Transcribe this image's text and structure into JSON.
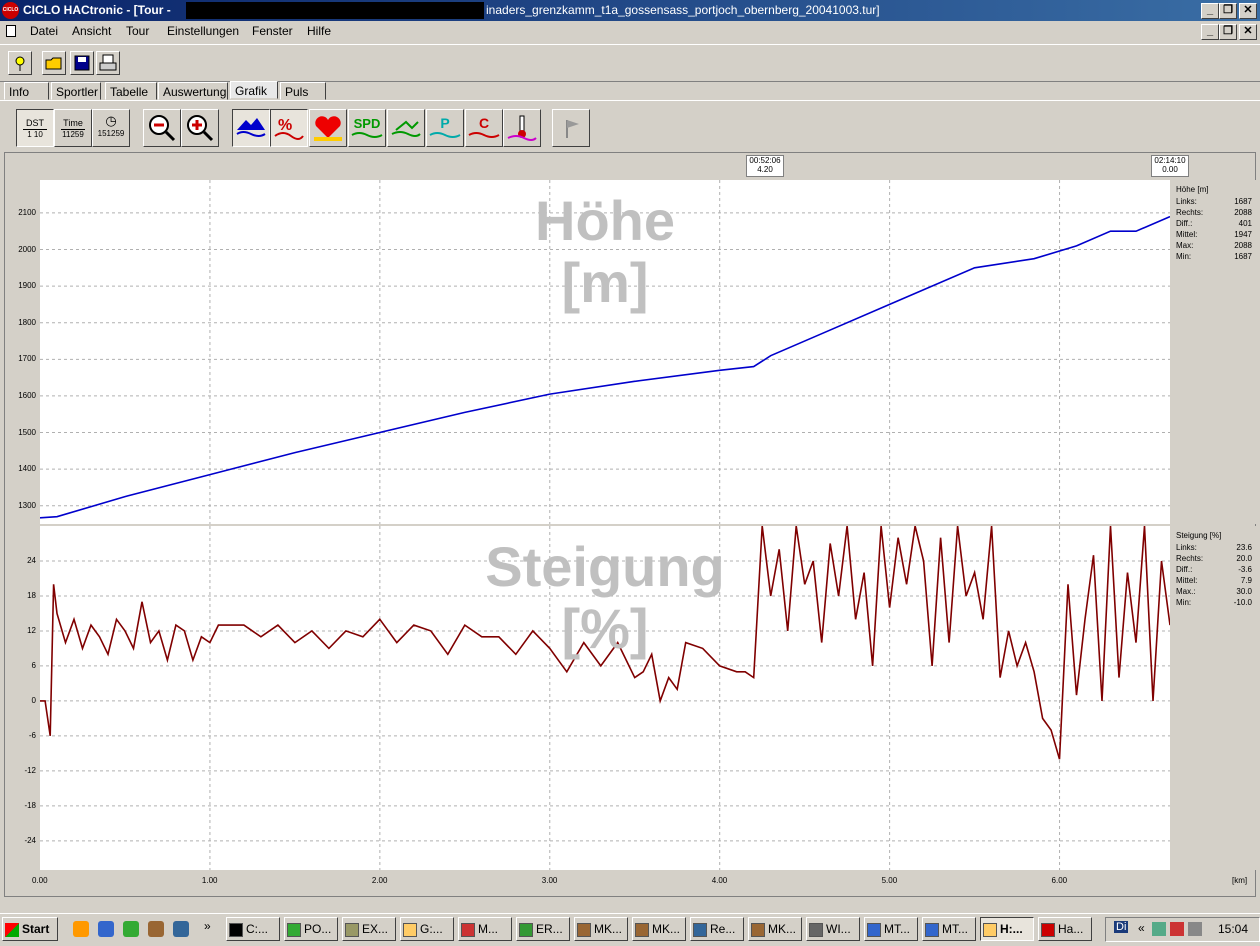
{
  "window": {
    "logo": "CICLO",
    "title_left": "CICLO HACtronic - [Tour -",
    "title_right": "inaders_grenzkamm_t1a_gossensass_portjoch_obernberg_20041003.tur]"
  },
  "menu": [
    "Datei",
    "Ansicht",
    "Tour",
    "Einstellungen",
    "Fenster",
    "Hilfe"
  ],
  "toolbar": [
    "new-icon",
    "open-icon",
    "save-icon",
    "print-icon"
  ],
  "tabs": [
    {
      "label": "Info"
    },
    {
      "label": "Sportler"
    },
    {
      "label": "Tabelle"
    },
    {
      "label": "Auswertung"
    },
    {
      "label": "Grafik",
      "active": true
    },
    {
      "label": "Puls"
    }
  ],
  "graph_toolbar": {
    "dst": {
      "label": "DST",
      "value": "1 10"
    },
    "time": {
      "label": "Time",
      "value": "11259"
    },
    "clock": {
      "value": "151259"
    },
    "spd_label": "SPD",
    "p_label": "P",
    "c_label": "C"
  },
  "markers": [
    {
      "time": "00:52:06",
      "value": "4.20"
    },
    {
      "time": "02:14:10",
      "value": "0.00"
    }
  ],
  "x_axis": {
    "unit": "[km]",
    "ticks": [
      "0.00",
      "1.00",
      "2.00",
      "3.00",
      "4.00",
      "5.00",
      "6.00"
    ]
  },
  "hoehe_panel": {
    "title": "Höhe [m]",
    "big_title": [
      "Höhe",
      "[m]"
    ],
    "stats": [
      {
        "k": "Links:",
        "v": "1687"
      },
      {
        "k": "Rechts:",
        "v": "2088"
      },
      {
        "k": "Diff.:",
        "v": "401"
      },
      {
        "k": "Mittel:",
        "v": "1947"
      },
      {
        "k": "Max:",
        "v": "2088"
      },
      {
        "k": "Min:",
        "v": "1687"
      }
    ]
  },
  "steigung_panel": {
    "title": "Steigung [%]",
    "big_title": [
      "Steigung",
      "[%]"
    ],
    "stats": [
      {
        "k": "Links:",
        "v": "23.6"
      },
      {
        "k": "Rechts:",
        "v": "20.0"
      },
      {
        "k": "Diff.:",
        "v": "-3.6"
      },
      {
        "k": "Mittel:",
        "v": "7.9"
      },
      {
        "k": "Max.:",
        "v": "30.0"
      },
      {
        "k": "Min:",
        "v": "-10.0"
      }
    ]
  },
  "chart_data": [
    {
      "type": "line",
      "title": "Höhe [m]",
      "xlabel": "[km]",
      "ylim": [
        1250,
        2190
      ],
      "xlim": [
        0,
        6.65
      ],
      "yticks": [
        1300,
        1400,
        1500,
        1600,
        1700,
        1800,
        1900,
        2000,
        2100
      ],
      "grid": true,
      "color": "#0000cc",
      "x": [
        0,
        0.1,
        0.5,
        1.0,
        1.5,
        2.0,
        2.5,
        3.0,
        3.5,
        4.0,
        4.2,
        4.3,
        4.6,
        5.0,
        5.5,
        5.85,
        6.1,
        6.3,
        6.45,
        6.65
      ],
      "y": [
        1267,
        1270,
        1325,
        1385,
        1445,
        1500,
        1555,
        1605,
        1640,
        1670,
        1680,
        1710,
        1770,
        1850,
        1950,
        1975,
        2010,
        2050,
        2050,
        2090
      ]
    },
    {
      "type": "line",
      "title": "Steigung [%]",
      "xlabel": "[km]",
      "ylim": [
        -29,
        30
      ],
      "xlim": [
        0,
        6.65
      ],
      "yticks": [
        24,
        18,
        12,
        6,
        0,
        -6,
        -12,
        -18,
        -24
      ],
      "ytick_labels": [
        "24",
        "18",
        "12",
        "6",
        "0",
        "-6",
        "-12",
        "-18",
        "-24"
      ],
      "grid": true,
      "color": "#800000",
      "x": [
        0.0,
        0.03,
        0.06,
        0.08,
        0.1,
        0.15,
        0.2,
        0.25,
        0.3,
        0.35,
        0.4,
        0.45,
        0.5,
        0.55,
        0.6,
        0.65,
        0.7,
        0.75,
        0.8,
        0.85,
        0.9,
        0.95,
        1.0,
        1.05,
        1.1,
        1.2,
        1.3,
        1.4,
        1.5,
        1.6,
        1.7,
        1.8,
        1.9,
        2.0,
        2.1,
        2.2,
        2.3,
        2.4,
        2.5,
        2.6,
        2.7,
        2.8,
        2.9,
        3.0,
        3.1,
        3.2,
        3.3,
        3.4,
        3.5,
        3.55,
        3.6,
        3.65,
        3.7,
        3.75,
        3.8,
        3.9,
        4.0,
        4.1,
        4.15,
        4.2,
        4.25,
        4.3,
        4.35,
        4.4,
        4.45,
        4.5,
        4.55,
        4.6,
        4.65,
        4.7,
        4.75,
        4.8,
        4.85,
        4.9,
        4.95,
        5.0,
        5.05,
        5.1,
        5.15,
        5.2,
        5.25,
        5.3,
        5.35,
        5.4,
        5.45,
        5.5,
        5.55,
        5.6,
        5.65,
        5.7,
        5.75,
        5.8,
        5.85,
        5.9,
        5.95,
        6.0,
        6.05,
        6.1,
        6.15,
        6.2,
        6.25,
        6.3,
        6.35,
        6.4,
        6.45,
        6.5,
        6.55,
        6.6,
        6.65
      ],
      "y": [
        0,
        0,
        -6,
        20,
        15,
        10,
        14,
        9,
        13,
        11,
        8,
        14,
        12,
        9,
        17,
        10,
        12,
        7,
        13,
        12,
        7,
        11,
        10,
        13,
        13,
        13,
        11,
        13,
        10,
        12,
        9,
        12,
        11,
        14,
        10,
        13,
        12,
        8,
        13,
        11,
        11,
        8,
        12,
        9,
        5,
        10,
        6,
        10,
        4,
        5,
        8,
        0,
        4,
        2,
        10,
        9,
        6,
        5,
        5,
        4,
        30,
        18,
        26,
        12,
        30,
        20,
        24,
        10,
        27,
        18,
        30,
        14,
        22,
        6,
        30,
        16,
        28,
        20,
        30,
        24,
        6,
        28,
        10,
        30,
        18,
        22,
        14,
        30,
        4,
        12,
        6,
        10,
        5,
        -3,
        -5,
        -10,
        20,
        1,
        14,
        25,
        0,
        30,
        4,
        22,
        10,
        30,
        0,
        24,
        13
      ]
    }
  ],
  "taskbar": {
    "start": "Start",
    "quicklaunch": [
      "winamp-icon",
      "ie-icon",
      "refresh-icon",
      "app-icon",
      "net-icon"
    ],
    "chevron": "»",
    "items": [
      {
        "label": "C:..."
      },
      {
        "label": "PO..."
      },
      {
        "label": "EX..."
      },
      {
        "label": "G:..."
      },
      {
        "label": "M..."
      },
      {
        "label": "ER..."
      },
      {
        "label": "MK..."
      },
      {
        "label": "MK..."
      },
      {
        "label": "Re..."
      },
      {
        "label": "MK..."
      },
      {
        "label": "WI..."
      },
      {
        "label": "MT..."
      },
      {
        "label": "MT..."
      },
      {
        "label": "H:...",
        "active": true
      },
      {
        "label": "Ha..."
      }
    ],
    "tray_left": "Di",
    "tray_chevron": "«",
    "clock": "15:04"
  }
}
